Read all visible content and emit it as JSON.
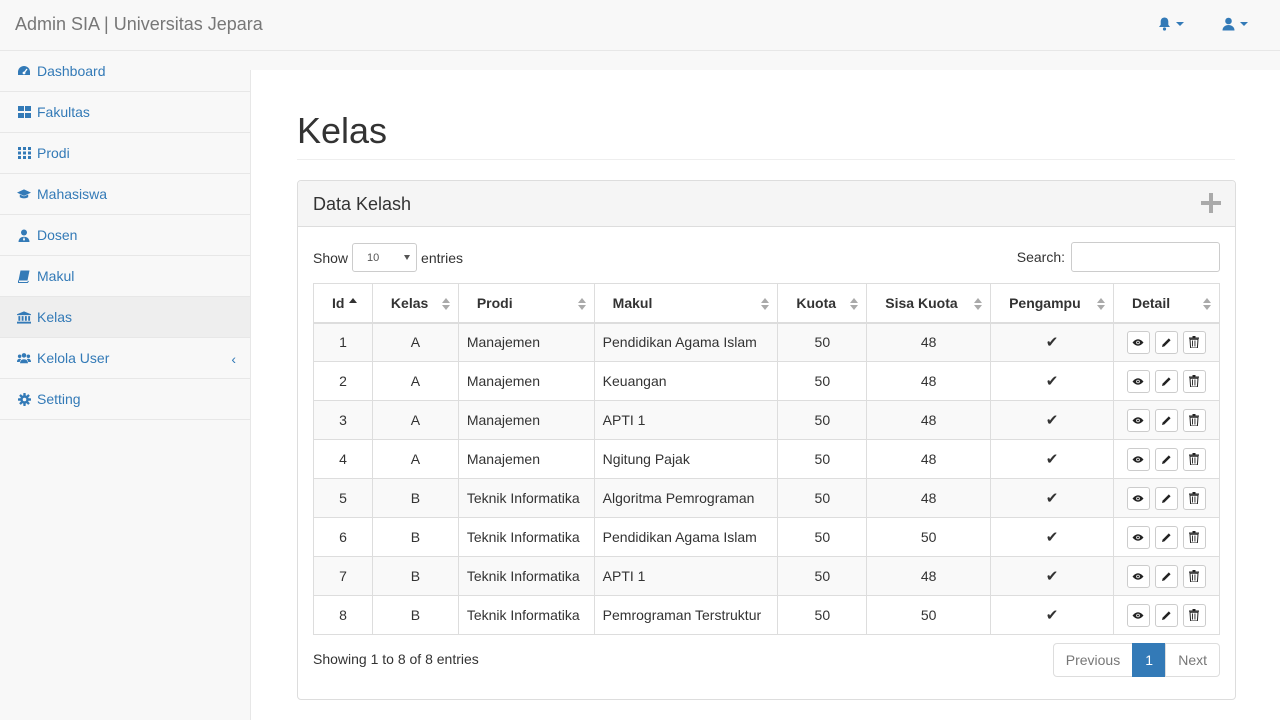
{
  "navbar": {
    "brand": "Admin SIA | Universitas Jepara",
    "icons": [
      "bell-icon",
      "user-icon"
    ]
  },
  "sidebar": {
    "items": [
      {
        "label": "Dashboard",
        "icon": "dashboard-icon"
      },
      {
        "label": "Fakultas",
        "icon": "grid-large-icon"
      },
      {
        "label": "Prodi",
        "icon": "grid-small-icon"
      },
      {
        "label": "Mahasiswa",
        "icon": "graduation-cap-icon"
      },
      {
        "label": "Dosen",
        "icon": "user-tie-icon"
      },
      {
        "label": "Makul",
        "icon": "book-icon"
      },
      {
        "label": "Kelas",
        "icon": "institution-icon",
        "active": true
      },
      {
        "label": "Kelola User",
        "icon": "users-icon",
        "has_submenu": true
      },
      {
        "label": "Setting",
        "icon": "cog-icon"
      }
    ]
  },
  "page": {
    "title": "Kelas"
  },
  "panel": {
    "title": "Data Kelash",
    "show_label": "Show",
    "entries_label": "entries",
    "page_length": "10",
    "search_label": "Search:",
    "search_value": ""
  },
  "table": {
    "columns": [
      "Id",
      "Kelas",
      "Prodi",
      "Makul",
      "Kuota",
      "Sisa Kuota",
      "Pengampu",
      "Detail"
    ],
    "rows": [
      {
        "id": "1",
        "kelas": "A",
        "prodi": "Manajemen",
        "makul": "Pendidikan Agama Islam",
        "kuota": "50",
        "sisa": "48"
      },
      {
        "id": "2",
        "kelas": "A",
        "prodi": "Manajemen",
        "makul": "Keuangan",
        "kuota": "50",
        "sisa": "48"
      },
      {
        "id": "3",
        "kelas": "A",
        "prodi": "Manajemen",
        "makul": "APTI 1",
        "kuota": "50",
        "sisa": "48"
      },
      {
        "id": "4",
        "kelas": "A",
        "prodi": "Manajemen",
        "makul": "Ngitung Pajak",
        "kuota": "50",
        "sisa": "48"
      },
      {
        "id": "5",
        "kelas": "B",
        "prodi": "Teknik Informatika",
        "makul": "Algoritma Pemrograman",
        "kuota": "50",
        "sisa": "48"
      },
      {
        "id": "6",
        "kelas": "B",
        "prodi": "Teknik Informatika",
        "makul": "Pendidikan Agama Islam",
        "kuota": "50",
        "sisa": "50"
      },
      {
        "id": "7",
        "kelas": "B",
        "prodi": "Teknik Informatika",
        "makul": "APTI 1",
        "kuota": "50",
        "sisa": "48"
      },
      {
        "id": "8",
        "kelas": "B",
        "prodi": "Teknik Informatika",
        "makul": "Pemrograman Terstruktur",
        "kuota": "50",
        "sisa": "50"
      }
    ],
    "check_glyph": "✔"
  },
  "footer": {
    "info": "Showing 1 to 8 of 8 entries",
    "prev": "Previous",
    "current": "1",
    "next": "Next"
  },
  "colors": {
    "link": "#337ab7",
    "active_page": "#337ab7"
  }
}
